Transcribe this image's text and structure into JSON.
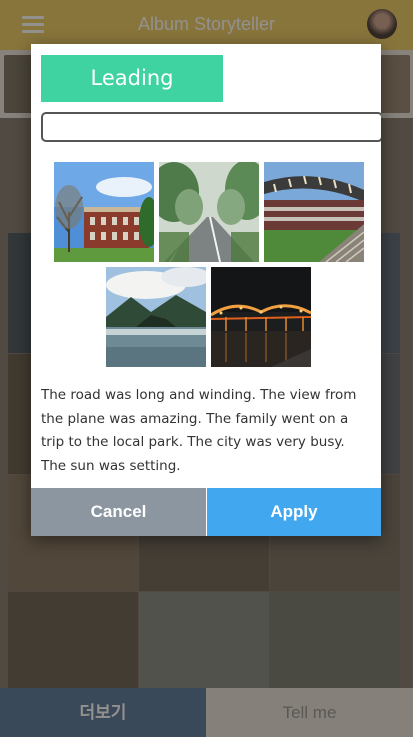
{
  "app": {
    "title": "Album Storyteller",
    "footer": {
      "more_label": "더보기",
      "tell_label": "Tell me"
    }
  },
  "dialog": {
    "title": "Leading sentence",
    "input": {
      "value": "",
      "placeholder": ""
    },
    "photos": [
      {
        "subject": "red brick building with tree"
      },
      {
        "subject": "tree-lined road in fog"
      },
      {
        "subject": "stadium seating"
      },
      {
        "subject": "lake and mountains"
      },
      {
        "subject": "lit bridge at night"
      }
    ],
    "story": "The road was long and winding. The view from the plane was amazing. The family went on a trip to the local park. The city was very busy. The sun was setting.",
    "cancel_label": "Cancel",
    "apply_label": "Apply"
  },
  "colors": {
    "header": "#e9c75a",
    "title_badge": "#3ed3a1",
    "cancel": "#8c96a0",
    "apply": "#41a8f0"
  }
}
